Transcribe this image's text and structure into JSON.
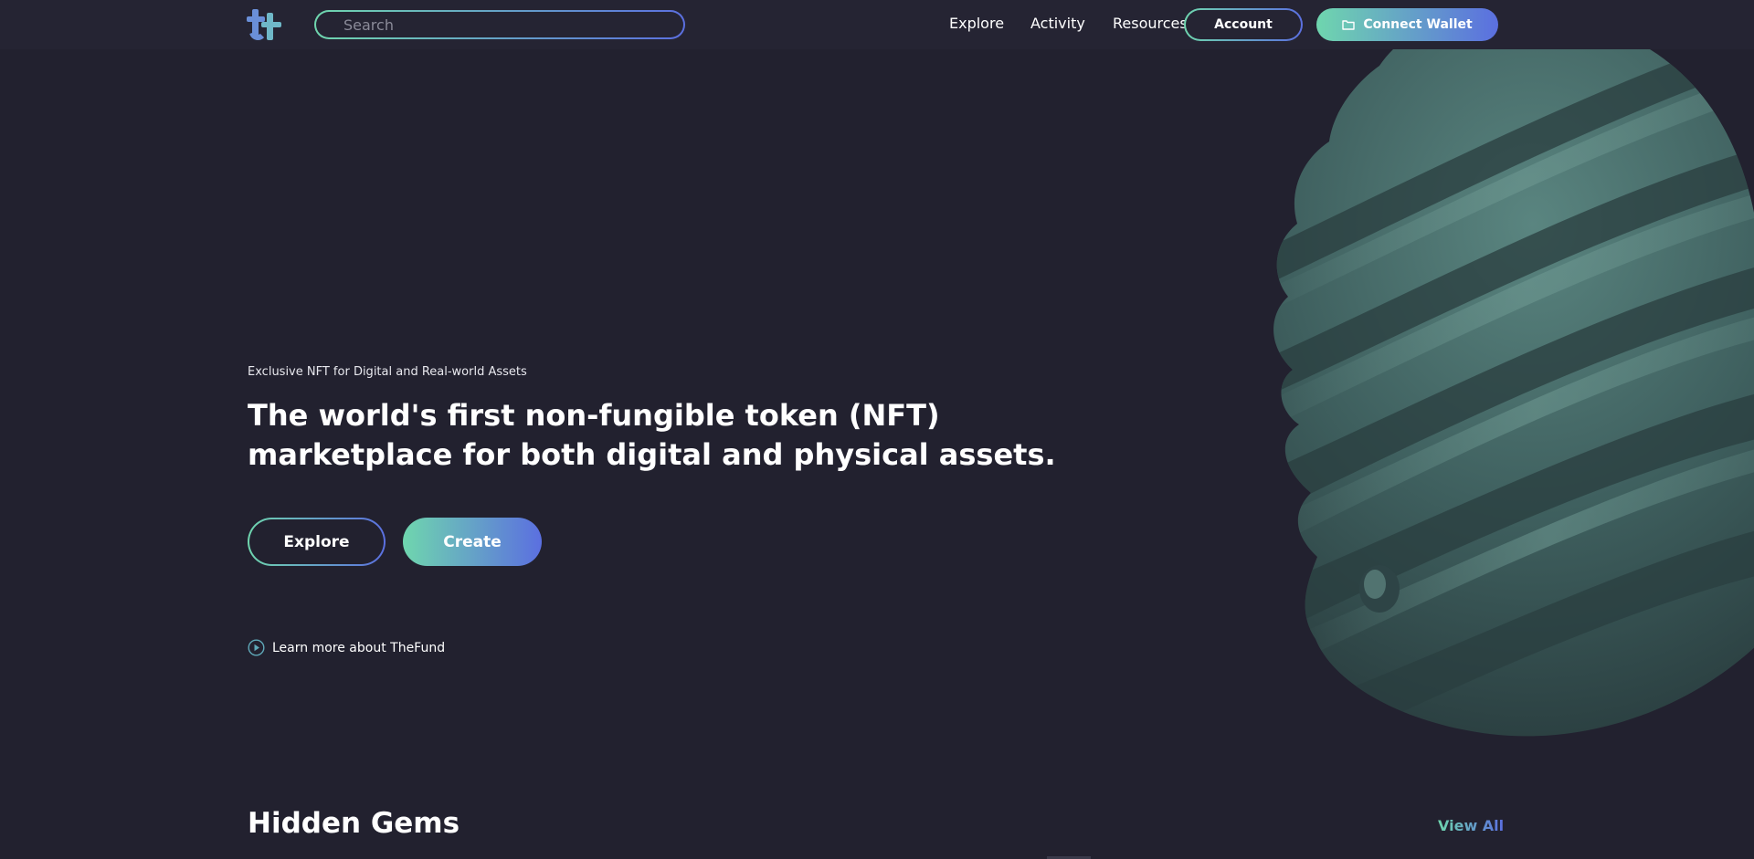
{
  "header": {
    "logo_icon": "thefund-logo-icon",
    "search": {
      "placeholder": "Search",
      "value": ""
    },
    "nav": [
      {
        "label": "Explore"
      },
      {
        "label": "Activity"
      },
      {
        "label": "Resources"
      }
    ],
    "account_label": "Account",
    "connect_wallet": {
      "label": "Connect Wallet",
      "icon": "wallet-icon"
    }
  },
  "hero": {
    "eyebrow": "Exclusive NFT for Digital and Real-world Assets",
    "title": "The world's first non-fungible token (NFT) marketplace for both digital and physical assets.",
    "explore_label": "Explore",
    "create_label": "Create",
    "learn_more": {
      "label": "Learn more about TheFund",
      "icon": "play-circle-icon"
    },
    "image": "twisted-sphere-image"
  },
  "hidden_gems": {
    "title": "Hidden Gems",
    "view_all_label": "View All"
  },
  "colors": {
    "background": "#22212f",
    "header_background": "#252433",
    "accent_start": "#6fd6ae",
    "accent_end": "#5b6fe0",
    "orb": "#3e5f5e"
  }
}
